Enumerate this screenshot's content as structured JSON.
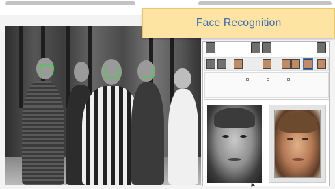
{
  "title_banner": {
    "text": "Face Recognition",
    "background": "#fde4a2",
    "text_color": "#3d6fb4"
  },
  "video": {
    "detection_box_color": "#41d441"
  },
  "panel": {
    "top_thumbnails": [
      "face-thumb",
      "face-thumb",
      "face-thumb",
      "face-thumb"
    ],
    "candidate_thumbnails": [
      "gray",
      "gray",
      "color",
      "color",
      "color",
      "color",
      "color",
      "color"
    ],
    "selected_candidate": 5
  }
}
